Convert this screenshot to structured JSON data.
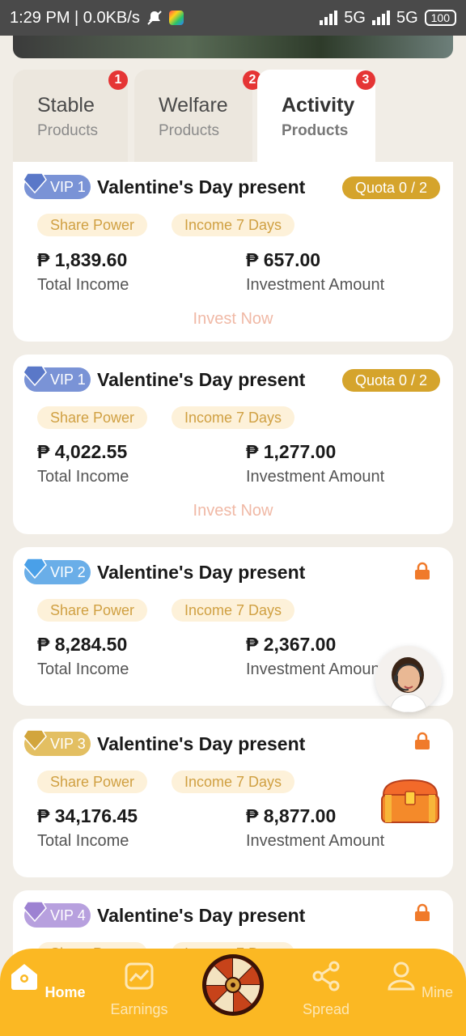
{
  "status_bar": {
    "time_speed": "1:29 PM | 0.0KB/s",
    "network1": "5G",
    "network2": "5G",
    "battery": "100"
  },
  "tabs": [
    {
      "title": "Stable",
      "sub": "Products",
      "badge": "1"
    },
    {
      "title": "Welfare",
      "sub": "Products",
      "badge": "2"
    },
    {
      "title": "Activity",
      "sub": "Products",
      "badge": "3"
    }
  ],
  "products": [
    {
      "vip": "VIP 1",
      "vip_color": "#7a93d6",
      "title": "Valentine's Day present",
      "quota": "Quota 0 / 2",
      "tag1": "Share Power",
      "tag2": "Income 7 Days",
      "total_income": "₱ 1,839.60",
      "total_income_label": "Total Income",
      "investment": "₱ 657.00",
      "investment_label": "Investment Amount",
      "action": "Invest Now"
    },
    {
      "vip": "VIP 1",
      "vip_color": "#7a93d6",
      "title": "Valentine's Day present",
      "quota": "Quota 0 / 2",
      "tag1": "Share Power",
      "tag2": "Income 7 Days",
      "total_income": "₱ 4,022.55",
      "total_income_label": "Total Income",
      "investment": "₱ 1,277.00",
      "investment_label": "Investment Amount",
      "action": "Invest Now"
    },
    {
      "vip": "VIP 2",
      "vip_color": "#6aaee8",
      "title": "Valentine's Day present",
      "tag1": "Share Power",
      "tag2": "Income 7 Days",
      "total_income": "₱ 8,284.50",
      "total_income_label": "Total Income",
      "investment": "₱ 2,367.00",
      "investment_label": "Investment Amount"
    },
    {
      "vip": "VIP 3",
      "vip_color": "#e3bf62",
      "title": "Valentine's Day present",
      "tag1": "Share Power",
      "tag2": "Income 7 Days",
      "total_income": "₱ 34,176.45",
      "total_income_label": "Total Income",
      "investment": "₱ 8,877.00",
      "investment_label": "Investment Amount"
    },
    {
      "vip": "VIP 4",
      "vip_color": "#b7a0de",
      "title": "Valentine's Day present",
      "tag1": "Share Power",
      "tag2": "Income 7 Days"
    }
  ],
  "bottom_nav": [
    {
      "label": "Home",
      "icon": "home-icon"
    },
    {
      "label": "Earnings",
      "icon": "earnings-icon"
    },
    {
      "label": "Spread",
      "icon": "share-icon"
    },
    {
      "label": "Mine",
      "icon": "user-icon"
    }
  ],
  "colors": {
    "accent": "#fbb823",
    "quota": "#d5a42c",
    "lock": "#f07a2a",
    "badge": "#e53535"
  }
}
